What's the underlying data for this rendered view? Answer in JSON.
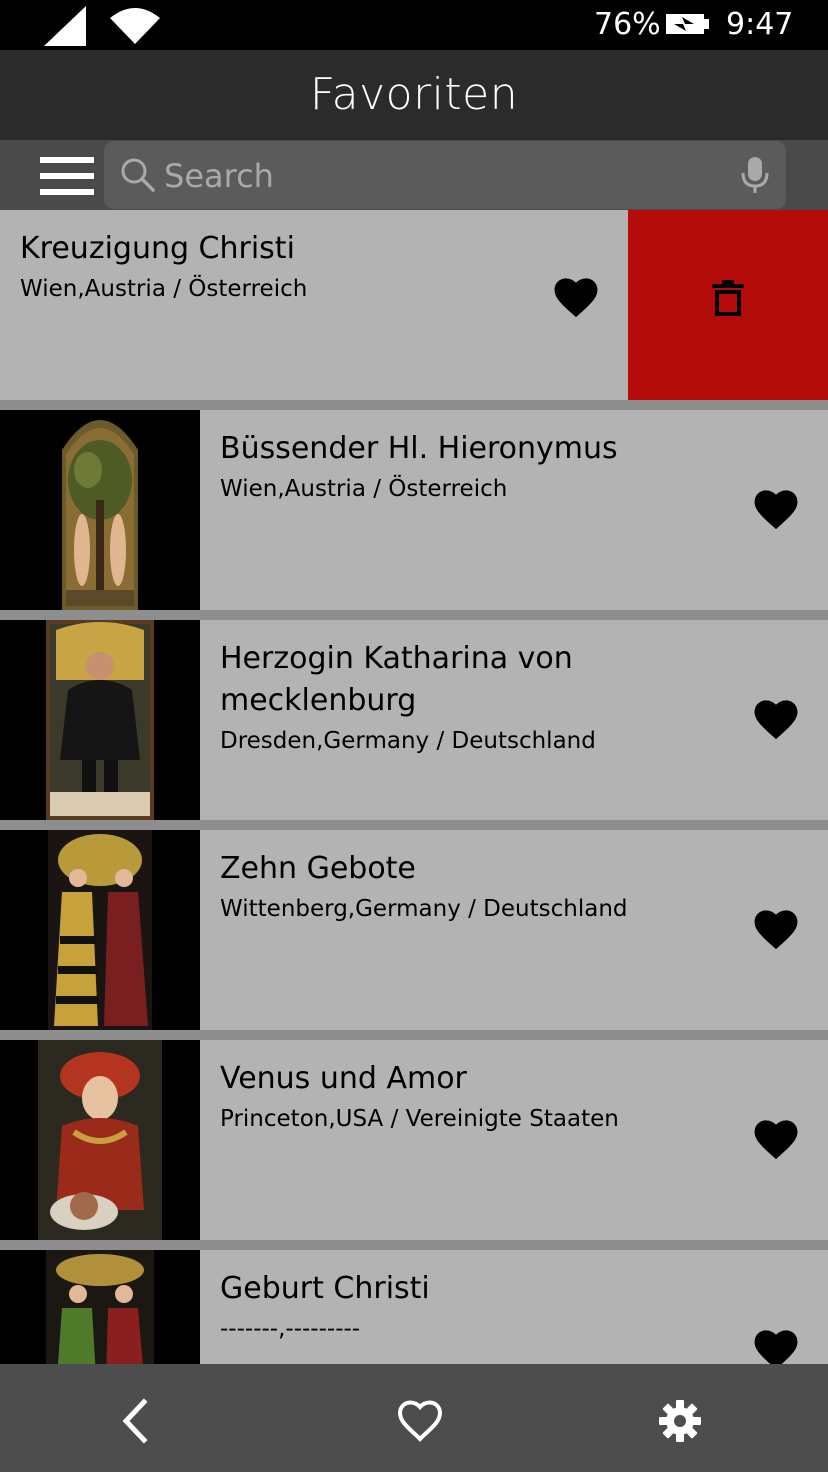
{
  "status_bar": {
    "battery_percent": "76%",
    "time": "9:47",
    "icons": [
      "cell-signal-icon",
      "wifi-icon",
      "battery-charging-icon"
    ]
  },
  "header": {
    "title": "Favoriten"
  },
  "search": {
    "placeholder": "Search",
    "value": ""
  },
  "list": {
    "items": [
      {
        "title": "Kreuzigung Christi",
        "location": "Wien,Austria / Österreich",
        "favorited": true,
        "swiped_open": true
      },
      {
        "title": "Büssender Hl. Hieronymus",
        "location": "Wien,Austria / Österreich",
        "favorited": true
      },
      {
        "title": "Herzogin Katharina von mecklenburg",
        "location": "Dresden,Germany / Deutschland",
        "favorited": true
      },
      {
        "title": "Zehn Gebote",
        "location": "Wittenberg,Germany / Deutschland",
        "favorited": true
      },
      {
        "title": "Venus und Amor",
        "location": "Princeton,USA / Vereinigte Staaten",
        "favorited": true
      },
      {
        "title": "Geburt Christi",
        "location": "-------,---------",
        "favorited": true
      }
    ]
  },
  "bottom_nav": {
    "icons": [
      "back-chevron-icon",
      "heart-outline-icon",
      "gear-icon"
    ]
  },
  "colors": {
    "status_bar": "#000000",
    "title_bar": "#2b2b2b",
    "search_bar": "#4a4a4a",
    "row_background": "#b3b3b3",
    "separator": "#8e8e8e",
    "delete": "#b40b0b",
    "bottom_bar": "#4d4d4d"
  }
}
